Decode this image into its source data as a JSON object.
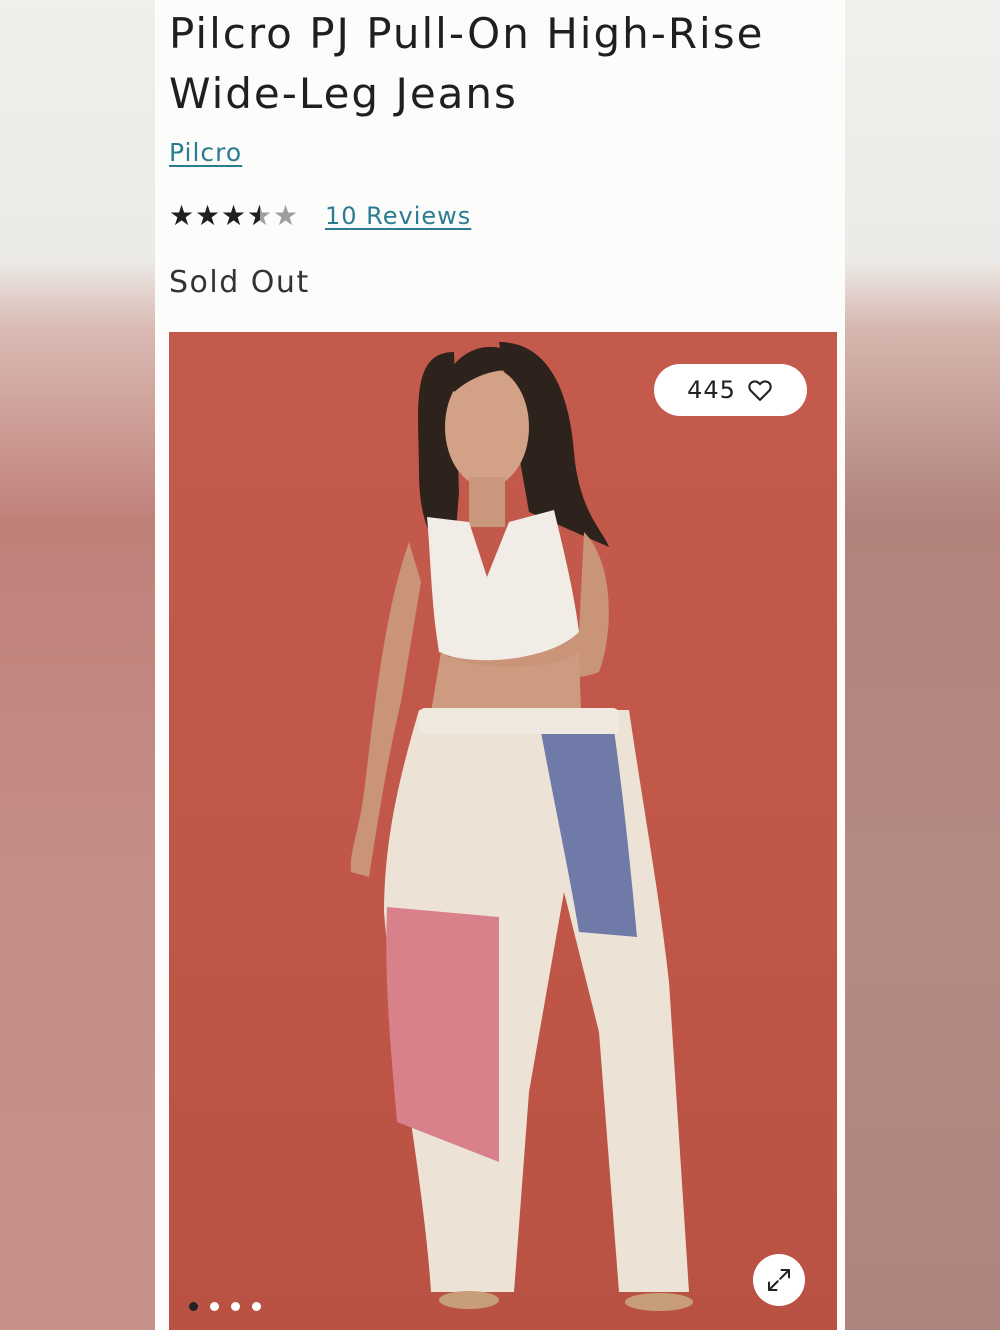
{
  "product": {
    "title": "Pilcro PJ Pull-On High-Rise Wide-Leg Jeans",
    "brand": "Pilcro",
    "rating": {
      "value": 3.5,
      "max": 5,
      "reviews_label": "10 Reviews"
    },
    "status": "Sold Out"
  },
  "gallery": {
    "like_count": "445",
    "like_icon": "heart-icon",
    "expand_icon": "expand-icon",
    "dots": {
      "count": 4,
      "active_index": 0
    }
  },
  "colors": {
    "link": "#2b7c93",
    "backdrop": "#c25849"
  }
}
